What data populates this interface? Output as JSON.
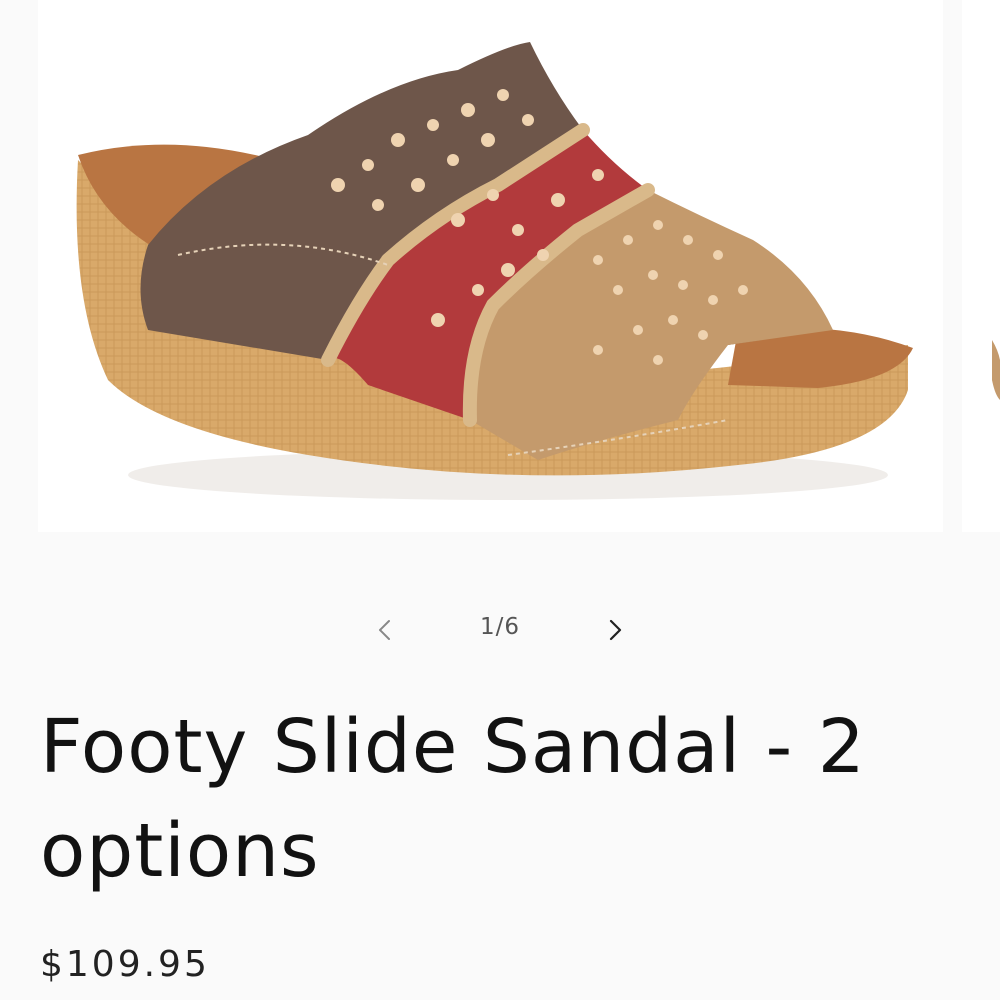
{
  "carousel": {
    "current_image": 1,
    "total_images": 6,
    "counter_text": "1/6",
    "prev_icon": "chevron-left-icon",
    "next_icon": "chevron-right-icon",
    "image_subject": "leather cut-out slide sandal"
  },
  "product": {
    "title": "Footy Slide Sandal - 2 options",
    "price": "$109.95"
  },
  "colors": {
    "background": "#fafafa",
    "title_text": "#121212",
    "leather_brown": "#6e564a",
    "leather_red": "#b23a3c",
    "leather_tan": "#c49a6c",
    "cork_sole": "#d8a868"
  }
}
